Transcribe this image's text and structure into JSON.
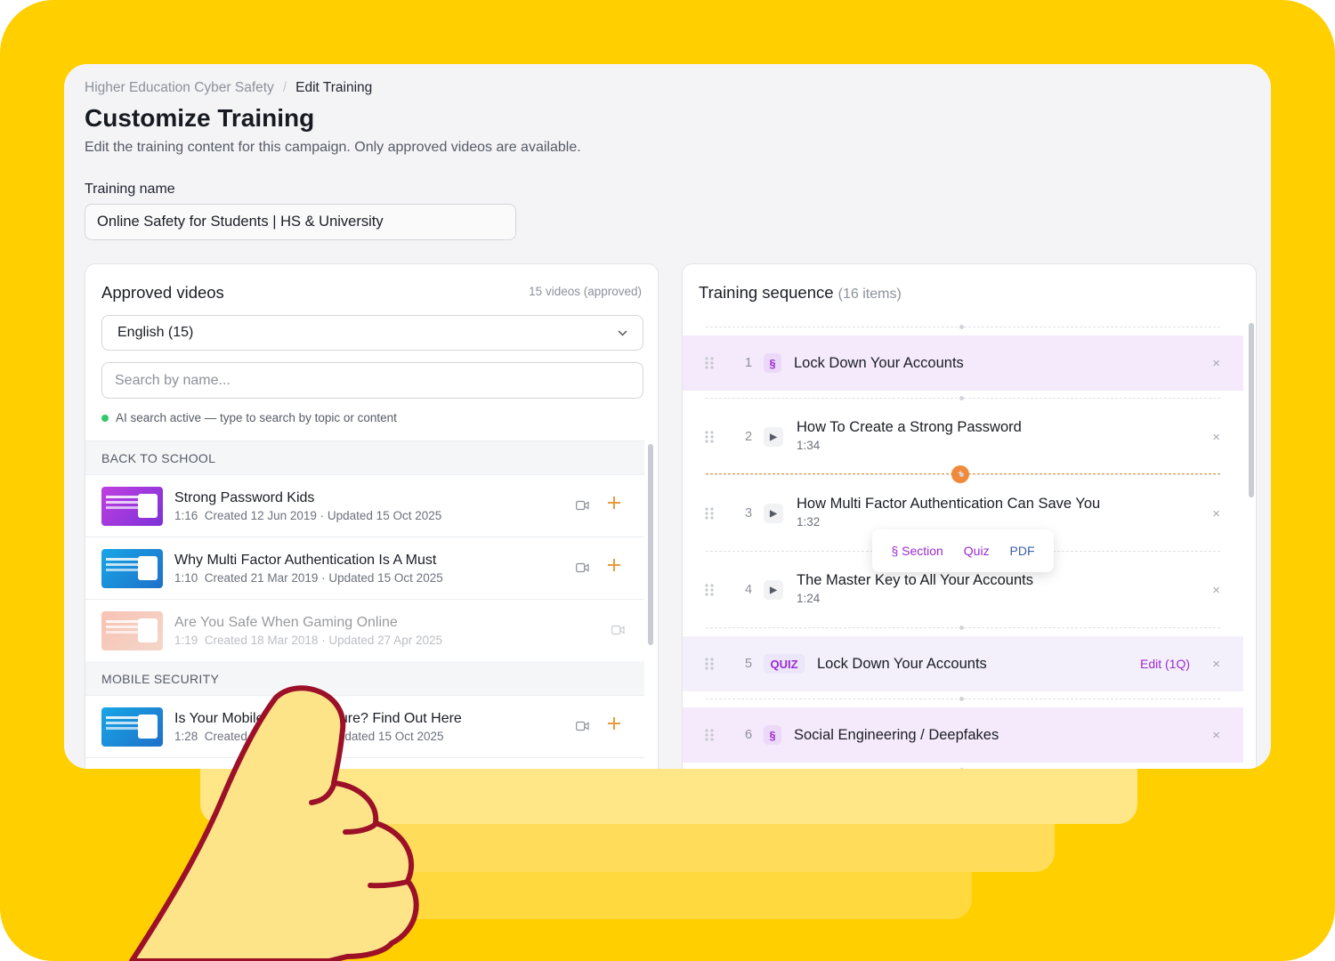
{
  "breadcrumb": {
    "parent": "Higher Education Cyber Safety",
    "separator": "/",
    "current": "Edit Training"
  },
  "page": {
    "title": "Customize Training",
    "subtitle": "Edit the training content for this campaign. Only approved videos are available.",
    "name_label": "Training name",
    "name_value": "Online Safety for Students | HS & University"
  },
  "approved": {
    "title": "Approved videos",
    "meta": "15 videos (approved)",
    "language": "English (15)",
    "search_placeholder": "Search by name...",
    "ai_status": "AI search active — type to search by topic or content",
    "groups": [
      {
        "name": "BACK TO SCHOOL",
        "videos": [
          {
            "title": "Strong Password Kids",
            "duration": "1:16",
            "dates": "Created 12 Jun 2019 · Updated 15 Oct 2025",
            "thumb": "purple",
            "enabled": true
          },
          {
            "title": "Why Multi Factor Authentication Is A Must",
            "duration": "1:10",
            "dates": "Created 21 Mar 2019 · Updated 15 Oct 2025",
            "thumb": "blue",
            "enabled": true
          },
          {
            "title": "Are You Safe When Gaming Online",
            "duration": "1:19",
            "dates": "Created 18 Mar 2018 · Updated 27 Apr 2025",
            "thumb": "coral",
            "enabled": false
          }
        ]
      },
      {
        "name": "MOBILE SECURITY",
        "videos": [
          {
            "title": "Is Your Mobile Device Secure? Find Out Here",
            "duration": "1:28",
            "dates": "Created 13 Sep 2019 · Updated 15 Oct 2025",
            "thumb": "blue",
            "enabled": true
          }
        ]
      }
    ]
  },
  "sequence": {
    "title": "Training sequence",
    "count": "(16 items)",
    "items": [
      {
        "num": "1",
        "type": "section",
        "badge": "§",
        "title": "Lock Down Your Accounts"
      },
      {
        "num": "2",
        "type": "video",
        "title": "How To Create a Strong Password",
        "duration": "1:34"
      },
      {
        "num": "3",
        "type": "video",
        "title": "How Multi Factor Authentication Can Save You",
        "duration": "1:32"
      },
      {
        "num": "4",
        "type": "video",
        "title": "The Master Key to All Your Accounts",
        "duration": "1:24"
      },
      {
        "num": "5",
        "type": "quiz",
        "badge": "QUIZ",
        "title": "Lock Down Your Accounts",
        "edit": "Edit (1Q)"
      },
      {
        "num": "6",
        "type": "section",
        "badge": "§",
        "title": "Social Engineering / Deepfakes"
      }
    ],
    "insert_menu": {
      "section": "§ Section",
      "quiz": "Quiz",
      "pdf": "PDF"
    },
    "remove_symbol": "×",
    "insert_symbol": "+"
  },
  "colors": {
    "brand_yellow": "#ffcf00",
    "accent_purple": "#9b2bd1",
    "accent_orange": "#e79b3d",
    "ai_green": "#35c86a"
  },
  "icons": [
    "drag-handle-icon",
    "play-icon",
    "camera-icon",
    "plus-icon",
    "close-icon",
    "chevron-down-icon",
    "thumbs-up-hand-icon"
  ]
}
